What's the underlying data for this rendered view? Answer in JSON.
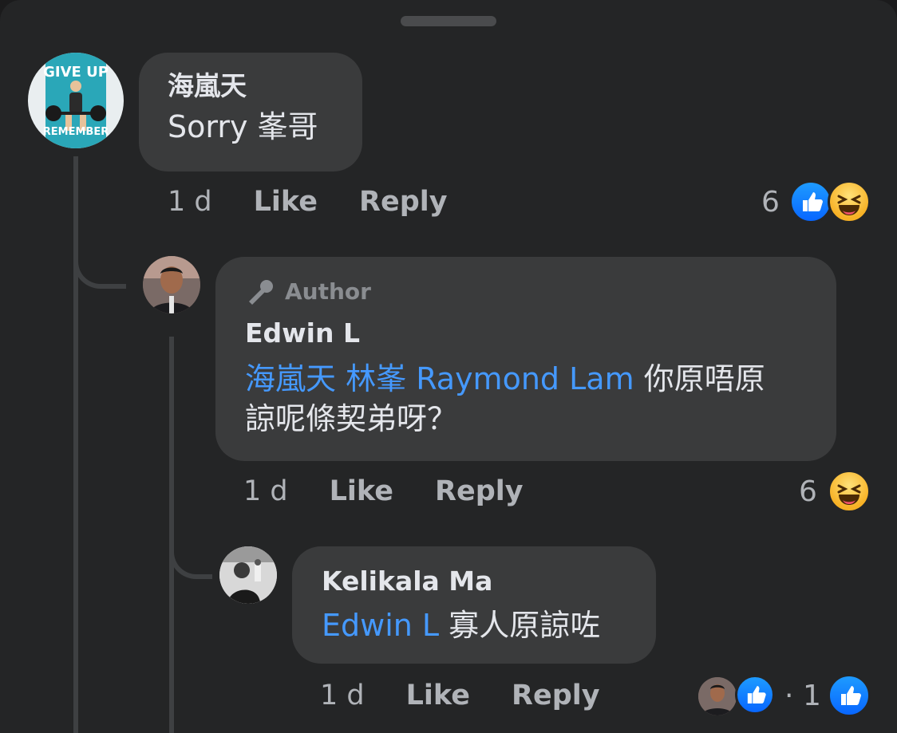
{
  "comments": [
    {
      "author": "海嵐天",
      "text": "Sorry 峯哥",
      "time": "1 d",
      "like_label": "Like",
      "reply_label": "Reply",
      "reaction_count": "6"
    },
    {
      "badge": "Author",
      "author": "Edwin L",
      "mentions": [
        "海嵐天",
        "林峯",
        "Raymond Lam"
      ],
      "text_line1": "你原唔原",
      "text_line2": "諒呢條契弟呀？",
      "time": "1 d",
      "like_label": "Like",
      "reply_label": "Reply",
      "reaction_count": "6"
    },
    {
      "author": "Kelikala Ma",
      "mention": "Edwin L",
      "text": "寡人原諒咗",
      "time": "1 d",
      "like_label": "Like",
      "reply_label": "Reply",
      "reaction_separator": "·",
      "reaction_count": "1"
    }
  ],
  "avatar1_text": {
    "top": "GIVE UP",
    "bottom": "REMEMBER"
  },
  "colors": {
    "background": "#242526",
    "bubble": "#3a3b3c",
    "mention": "#4599ff",
    "secondary_text": "#b0b3b8",
    "like_blue": "#0866ff"
  },
  "icons": [
    "like-icon",
    "haha-icon",
    "microphone-icon"
  ]
}
